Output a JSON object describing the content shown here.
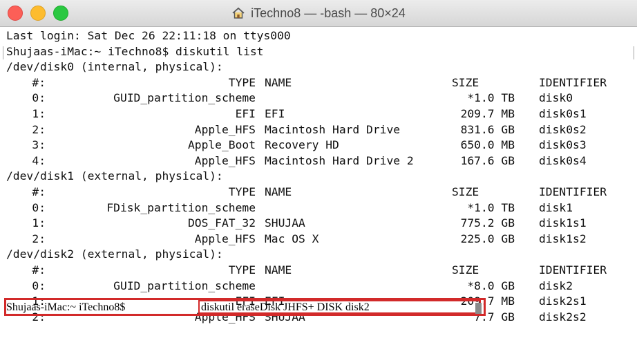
{
  "window": {
    "title": "iTechno8 — -bash — 80×24"
  },
  "terminal": {
    "last_login": "Last login: Sat Dec 26 22:11:18 on ttys000",
    "prompt_cmd": "Shujaas-iMac:~ iTechno8$ diskutil list",
    "final_prompt": "Shujaas-iMac:~ iTechno8$",
    "final_command": "diskutil eraseDisk JHFS+ DISK disk2",
    "headers": {
      "num": "#:",
      "type": "TYPE",
      "name": "NAME",
      "size": "SIZE",
      "identifier": "IDENTIFIER"
    },
    "disks": [
      {
        "device": "/dev/disk0 (internal, physical):",
        "rows": [
          {
            "num": "0:",
            "type": "GUID_partition_scheme",
            "name": "",
            "size": "*1.0 TB",
            "id": "disk0"
          },
          {
            "num": "1:",
            "type": "EFI",
            "name": "EFI",
            "size": "209.7 MB",
            "id": "disk0s1"
          },
          {
            "num": "2:",
            "type": "Apple_HFS",
            "name": "Macintosh Hard Drive",
            "size": "831.6 GB",
            "id": "disk0s2"
          },
          {
            "num": "3:",
            "type": "Apple_Boot",
            "name": "Recovery HD",
            "size": "650.0 MB",
            "id": "disk0s3"
          },
          {
            "num": "4:",
            "type": "Apple_HFS",
            "name": "Macintosh Hard Drive 2",
            "size": "167.6 GB",
            "id": "disk0s4"
          }
        ]
      },
      {
        "device": "/dev/disk1 (external, physical):",
        "rows": [
          {
            "num": "0:",
            "type": "FDisk_partition_scheme",
            "name": "",
            "size": "*1.0 TB",
            "id": "disk1"
          },
          {
            "num": "1:",
            "type": "DOS_FAT_32",
            "name": "SHUJAA",
            "size": "775.2 GB",
            "id": "disk1s1"
          },
          {
            "num": "2:",
            "type": "Apple_HFS",
            "name": "Mac OS X",
            "size": "225.0 GB",
            "id": "disk1s2"
          }
        ]
      },
      {
        "device": "/dev/disk2 (external, physical):",
        "rows": [
          {
            "num": "0:",
            "type": "GUID_partition_scheme",
            "name": "",
            "size": "*8.0 GB",
            "id": "disk2"
          },
          {
            "num": "1:",
            "type": "EFI",
            "name": "EFI",
            "size": "209.7 MB",
            "id": "disk2s1"
          },
          {
            "num": "2:",
            "type": "Apple_HFS",
            "name": "SHUJAA",
            "size": "7.7 GB",
            "id": "disk2s2"
          }
        ]
      }
    ]
  },
  "colors": {
    "highlight": "#d22a2a",
    "close": "#fc5f57",
    "minimize": "#fdbc2e",
    "maximize": "#2ac841"
  },
  "icons": {
    "title_icon": "home-icon"
  }
}
